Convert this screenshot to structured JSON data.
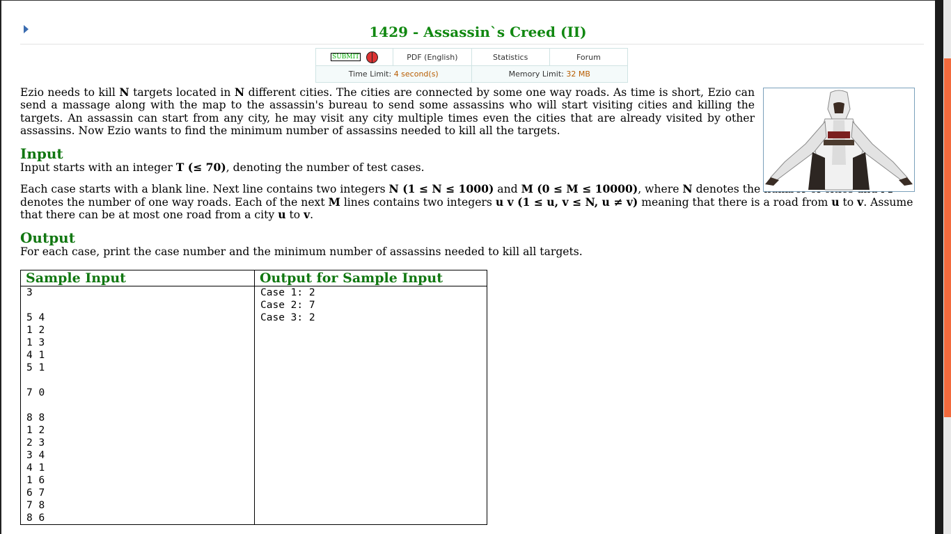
{
  "problem": {
    "title": "1429 - Assassin`s Creed (II)"
  },
  "toolbar": {
    "submit": "SUBMIT",
    "pdf": "PDF (English)",
    "statistics": "Statistics",
    "forum": "Forum",
    "time_limit_label": "Time Limit:",
    "time_limit_value": "4 second(s)",
    "memory_limit_label": "Memory Limit:",
    "memory_limit_value": "32 MB"
  },
  "statement": {
    "p1": [
      "Ezio needs to kill ",
      "N",
      " targets located in ",
      "N",
      " different cities. The cities are connected by some one way roads. As time is short, Ezio can send a massage along with the map to the assassin's bureau to send some assassins who will start visiting cities and killing the targets. An assassin can start from any city, he may visit any city multiple times even the cities that are already visited by other assassins. Now Ezio wants to find the minimum number of assassins needed to kill all the targets."
    ]
  },
  "input": {
    "heading": "Input",
    "p1": [
      "Input starts with an integer ",
      "T (≤ 70)",
      ", denoting the number of test cases."
    ],
    "p2": [
      "Each case starts with a blank line. Next line contains two integers ",
      "N (1 ≤ N ≤ 1000)",
      " and ",
      "M (0 ≤ M ≤ 10000)",
      ", where ",
      "N",
      " denotes the number of cities and ",
      "M",
      " denotes the number of one way roads. Each of the next ",
      "M",
      " lines contains two integers ",
      "u v (1 ≤ u, v ≤ N, u ≠ v)",
      " meaning that there is a road from ",
      "u",
      " to ",
      "v",
      ". Assume that there can be at most one road from a city ",
      "u",
      " to ",
      "v",
      "."
    ]
  },
  "output": {
    "heading": "Output",
    "text": "For each case, print the case number and the minimum number of assassins needed to kill all targets."
  },
  "sample": {
    "input_header": "Sample Input",
    "output_header": "Output for Sample Input",
    "input_text": "3\n\n5 4\n1 2\n1 3\n4 1\n5 1\n\n7 0\n\n8 8\n1 2\n2 3\n3 4\n4 1\n1 6\n6 7\n7 8\n8 6",
    "output_text": "Case 1: 2\nCase 2: 7\nCase 3: 2"
  },
  "colors": {
    "heading_green": "#117711",
    "limit_orange": "#b85c00",
    "scroll_thumb": "#f26a3d"
  }
}
